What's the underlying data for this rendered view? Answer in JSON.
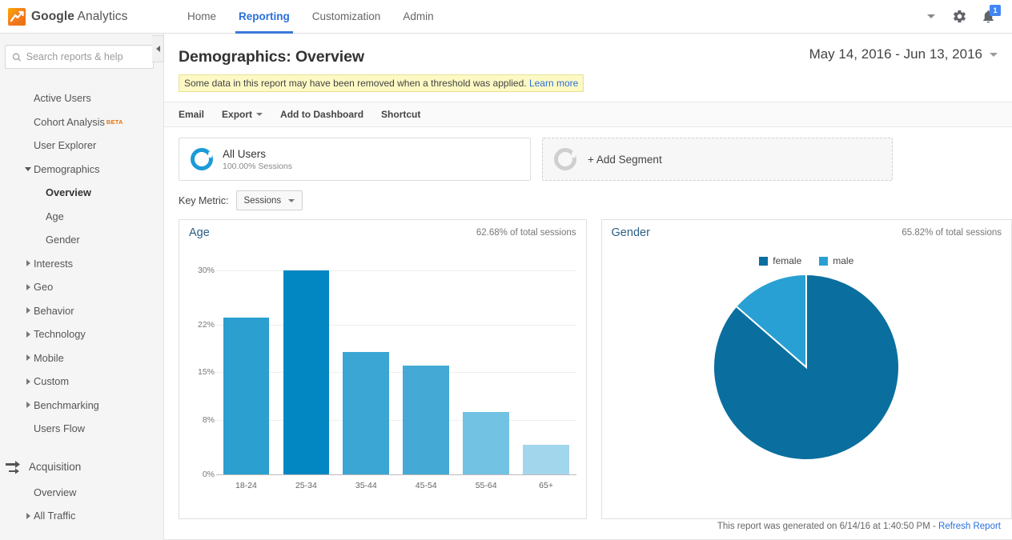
{
  "brand": {
    "name_bold": "Google",
    "name_light": " Analytics",
    "logo_icon": "analytics-logo-icon"
  },
  "topnav": {
    "items": [
      {
        "label": "Home",
        "active": false
      },
      {
        "label": "Reporting",
        "active": true
      },
      {
        "label": "Customization",
        "active": false
      },
      {
        "label": "Admin",
        "active": false
      }
    ],
    "account_caret_icon": "chevron-down-icon",
    "settings_icon": "gear-icon",
    "notifications_icon": "bell-icon",
    "notifications_count": "1"
  },
  "sidebar": {
    "search_placeholder": "Search reports & help",
    "search_value": "",
    "search_icon": "search-icon",
    "collapse_icon": "collapse-left-icon",
    "items": [
      {
        "label": "Active Users",
        "level": 1,
        "arrow": "none",
        "selected": false
      },
      {
        "label": "Cohort Analysis",
        "level": 1,
        "arrow": "none",
        "selected": false,
        "badge": "BETA"
      },
      {
        "label": "User Explorer",
        "level": 1,
        "arrow": "none",
        "selected": false
      },
      {
        "label": "Demographics",
        "level": 1,
        "arrow": "down",
        "selected": false
      },
      {
        "label": "Overview",
        "level": 2,
        "arrow": "none",
        "selected": true
      },
      {
        "label": "Age",
        "level": 2,
        "arrow": "none",
        "selected": false
      },
      {
        "label": "Gender",
        "level": 2,
        "arrow": "none",
        "selected": false
      },
      {
        "label": "Interests",
        "level": 1,
        "arrow": "right",
        "selected": false
      },
      {
        "label": "Geo",
        "level": 1,
        "arrow": "right",
        "selected": false
      },
      {
        "label": "Behavior",
        "level": 1,
        "arrow": "right",
        "selected": false
      },
      {
        "label": "Technology",
        "level": 1,
        "arrow": "right",
        "selected": false
      },
      {
        "label": "Mobile",
        "level": 1,
        "arrow": "right",
        "selected": false
      },
      {
        "label": "Custom",
        "level": 1,
        "arrow": "right",
        "selected": false
      },
      {
        "label": "Benchmarking",
        "level": 1,
        "arrow": "right",
        "selected": false
      },
      {
        "label": "Users Flow",
        "level": 1,
        "arrow": "none",
        "selected": false
      }
    ],
    "section": {
      "label": "Acquisition",
      "icon": "acquisition-arrows-icon"
    },
    "section_items": [
      {
        "label": "Overview",
        "level": 1,
        "arrow": "none",
        "selected": false
      },
      {
        "label": "All Traffic",
        "level": 1,
        "arrow": "right",
        "selected": false
      }
    ]
  },
  "page": {
    "title": "Demographics: Overview",
    "date_range": "May 14, 2016 - Jun 13, 2016",
    "date_caret_icon": "chevron-down-icon",
    "threshold_note": "Some data in this report may have been removed when a threshold was applied.",
    "threshold_link": "Learn more"
  },
  "toolbar": {
    "email_label": "Email",
    "export_label": "Export",
    "export_caret_icon": "chevron-down-icon",
    "add_dashboard_label": "Add to Dashboard",
    "shortcut_label": "Shortcut"
  },
  "segments": {
    "all_users_title": "All Users",
    "all_users_sub": "100.00% Sessions",
    "add_segment_label": "+ Add Segment"
  },
  "key_metric": {
    "label": "Key Metric:",
    "value": "Sessions",
    "caret_icon": "chevron-down-icon"
  },
  "footer": {
    "text": "This report was generated on 6/14/16 at 1:40:50 PM -",
    "link": "Refresh Report"
  },
  "chart_data": [
    {
      "type": "bar",
      "title": "Age",
      "meta": "62.68% of total sessions",
      "categories": [
        "18-24",
        "25-34",
        "35-44",
        "45-54",
        "55-64",
        "65+"
      ],
      "values": [
        23.0,
        30.0,
        18.0,
        16.0,
        9.2,
        4.4
      ],
      "colors": [
        "#2a9fd0",
        "#0387c2",
        "#3ba5d4",
        "#45a9d6",
        "#72c2e3",
        "#a2d6ec"
      ],
      "xlabel": "",
      "ylabel": "",
      "ylim": [
        0,
        31.5
      ],
      "yticks": [
        0,
        8,
        15,
        22,
        30
      ],
      "yticklabels": [
        "0%",
        "8%",
        "15%",
        "22%",
        "30%"
      ],
      "grid": true,
      "legend": "none"
    },
    {
      "type": "pie",
      "title": "Gender",
      "meta": "65.82% of total sessions",
      "categories": [
        "female",
        "male"
      ],
      "values": [
        86.4,
        13.6
      ],
      "labels": [
        "86.4%",
        "13.6%"
      ],
      "colors": [
        "#0a6f9e",
        "#29a0d4"
      ],
      "legend": "top"
    }
  ]
}
